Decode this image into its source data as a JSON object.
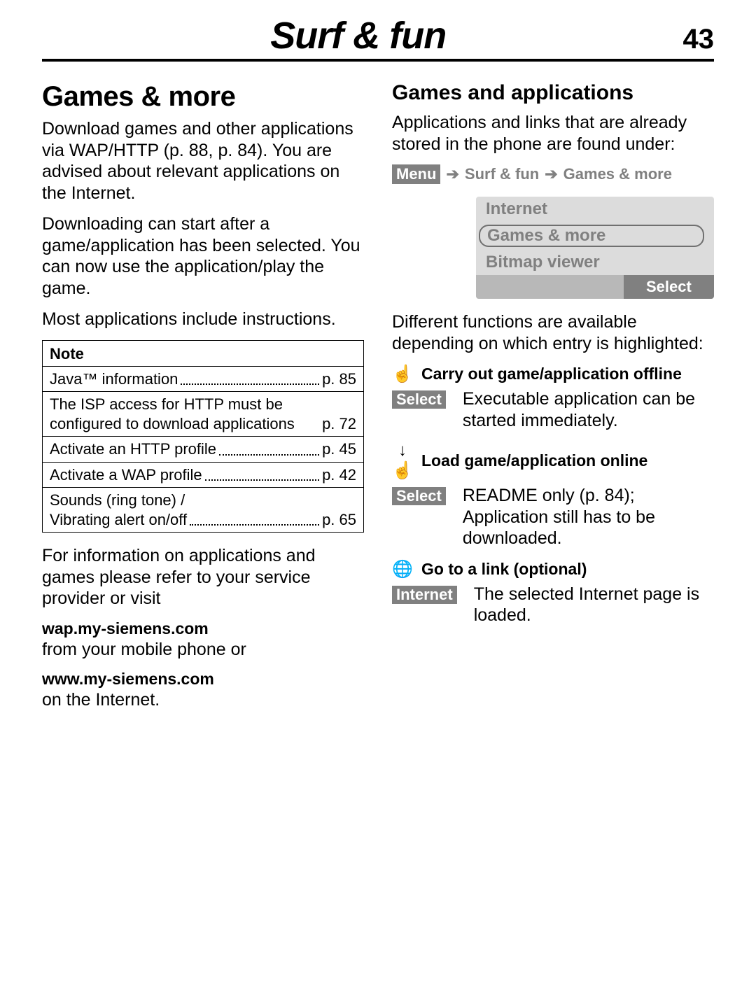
{
  "header": {
    "title": "Surf & fun",
    "page": "43"
  },
  "left": {
    "h1": "Games & more",
    "p1": "Download games and other applications via WAP/HTTP (p. 88, p. 84). You are advised about relevant applications on the Internet.",
    "p2": "Downloading can start after a game/application has been selected. You can now use the application/play the game.",
    "p3": "Most applications include instructions.",
    "note_title": "Note",
    "note_rows": [
      {
        "label": "Java™ information",
        "page": "p. 85"
      },
      {
        "label": "The ISP access for HTTP must be configured to download applications",
        "page": "p. 72",
        "multiline": true,
        "line1": "The ISP access for HTTP must be",
        "line2": "configured to download applications"
      },
      {
        "label": "Activate an HTTP profile",
        "page": "p. 45"
      },
      {
        "label": "Activate a WAP profile",
        "page": "p. 42"
      },
      {
        "label": "Sounds (ring tone) / Vibrating alert on/off",
        "page": "p. 65",
        "multiline": true,
        "line1": "Sounds (ring tone) /",
        "line2": "Vibrating alert on/off"
      }
    ],
    "p4": "For information on applications and games please refer to your service provider or visit",
    "link1": "wap.my-siemens.com",
    "after1": "from your mobile phone or",
    "link2": "www.my-siemens.com",
    "after2": "on the Internet."
  },
  "right": {
    "h2": "Games and applications",
    "p1": "Applications and links that are already stored in the phone are found under:",
    "breadcrumb": {
      "menu": "Menu",
      "a": "Surf & fun",
      "b": "Games & more"
    },
    "menu": {
      "items": [
        "Internet",
        "Games & more",
        "Bitmap viewer"
      ],
      "select": "Select"
    },
    "p2": "Different functions are available depending on which entry is highlighted:",
    "actions": [
      {
        "icon": "run-offline-icon",
        "glyph": "☝",
        "title": "Carry out game/application offline",
        "chip": "Select",
        "desc": "Executable application can be started immediately."
      },
      {
        "icon": "download-online-icon",
        "glyph": "↓☝",
        "title": "Load game/application online",
        "chip": "Select",
        "desc": "README only (p. 84); Application still has to be downloaded."
      },
      {
        "icon": "globe-icon",
        "glyph": "🌐",
        "title": "Go to a link (optional)",
        "chip": "Internet",
        "desc": "The selected Internet page is loaded."
      }
    ]
  }
}
